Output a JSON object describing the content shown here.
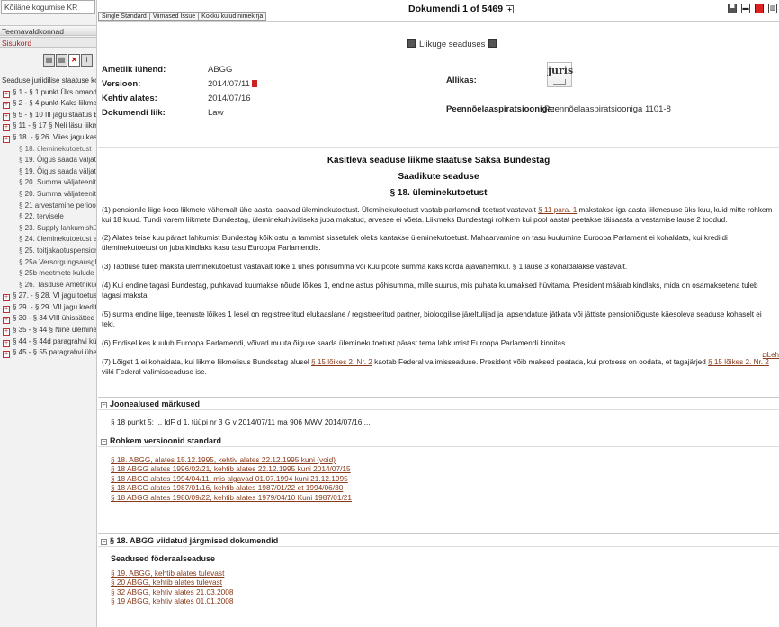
{
  "sidebar": {
    "title": "Kõiläne kogumise KR",
    "head1": "Teemavaldkonnad",
    "head2": "Sisukord",
    "icons": [
      "doc-icon",
      "doc-icon",
      "close-doc-icon",
      "info-icon"
    ],
    "tree": [
      {
        "text": "Seaduse juriidilise staatuse kohal Saks",
        "lvl": 0
      },
      {
        "text": "§ 1 - § 1 punkt Üks omandamist",
        "lvl": 1
      },
      {
        "text": "§ 2 - § 4 punkt Kaks liikmete Bur",
        "lvl": 1
      },
      {
        "text": "§ 5 - § 10 III jagu staatus Bunde",
        "lvl": 1
      },
      {
        "text": "§ 11 - § 17 § Neli läsu liikmed ...",
        "lvl": 1
      },
      {
        "text": "§ 18. - § 26. Viies jagu kasu end",
        "lvl": 1
      },
      {
        "text": "§ 18. üleminekutoetust",
        "lvl": 2,
        "selected": true
      },
      {
        "text": "§ 19. Õigus saada väljateenitud",
        "lvl": 2
      },
      {
        "text": "§ 19. Õigus saada väljateenitud",
        "lvl": 2
      },
      {
        "text": "§ 20. Summa väljateenitud aast",
        "lvl": 2
      },
      {
        "text": "§ 20. Summa väljateenitud aast",
        "lvl": 2
      },
      {
        "text": "§ 21 arvestamine perioodid teiste",
        "lvl": 2
      },
      {
        "text": "§ 22. tervisele",
        "lvl": 2
      },
      {
        "text": "§ 23. Supply lahkumishüvitist",
        "lvl": 2
      },
      {
        "text": "§ 24. üleminekutoetust ellujäänu",
        "lvl": 2
      },
      {
        "text": "§ 25. toitjakaotuspensionid",
        "lvl": 2
      },
      {
        "text": "§ 25a Versorgungsausgleich",
        "lvl": 2
      },
      {
        "text": "§ 25b meetmete kulude hoidmin",
        "lvl": 2
      },
      {
        "text": "§ 26. Tasduse Ametnikud õiguse",
        "lvl": 2
      },
      {
        "text": "§ 27. - § 28. VI jagu toetust kulu",
        "lvl": 1
      },
      {
        "text": "§ 29. - § 29. VII jagu krediteerim",
        "lvl": 1
      },
      {
        "text": "§ 30 - § 34 VIII ühissätted",
        "lvl": 1
      },
      {
        "text": "§ 35 - § 44 § Nine üleminekukor",
        "lvl": 1
      },
      {
        "text": "§ 44 - § 44d paragrahvi kümnes l",
        "lvl": 1
      },
      {
        "text": "§ 45 - § 55 paragrahvi üheteistku",
        "lvl": 1
      }
    ]
  },
  "topbar": {
    "tabs": [
      "Single Standard",
      "Viimased Issue",
      "Kokku kulud nimekirja"
    ],
    "doc_count": "Dokumendi 1 of 5469",
    "icons": [
      "save-icon",
      "print-icon",
      "pdf-icon",
      "layout-icon"
    ]
  },
  "main": {
    "link_law": "Liikuge seaduses",
    "meta": [
      {
        "label": "Ametlik lühend:",
        "value": "ABGG"
      },
      {
        "label": "Versioon:",
        "value": "2014/07/11"
      },
      {
        "label": "Kehtiv alates:",
        "value": "2014/07/16"
      },
      {
        "label": "Dokumendi liik:",
        "value": "Law"
      }
    ],
    "source_label": "Allikas:",
    "logo_text": "juris",
    "applicant_label": "Peennõelaaspiratsiooniga:",
    "applicant_value": "Peennõelaaspiratsiooniga 1101-8",
    "heading": [
      "Käsitleva seaduse liikme staatuse Saksa Bundestag",
      "Saadikute seaduse",
      "§ 18. üleminekutoetust"
    ],
    "p1_pre": "(1) pensionile liige koos liikmete vähemalt ühe aasta, saavad üleminekutoetust. Üleminekutoetust vastab parlamendi toetust vastavalt ",
    "p1_link": "§ 11 para. 1",
    "p1_post": " makstakse iga aasta liikmesuse üks kuu, kuid mitte rohkem kui 18 kuud. Tundi varem liikmete Bundestag, üleminekuhüvitiseks juba makstud, arvesse ei võeta. Liikmeks Bundestagi rohkem kui pool aastat peetakse täisaasta arvestamise lause 2 toodud.",
    "p2": "(2) Alates teise kuu pärast lahkumist Bundestag kõik ostu ja tammist sissetulek oleks kantakse üleminekutoetust. Mahaarvamine on tasu kuulumine Euroopa Parlament ei kohaldata, kui krediidi üleminekutoetust on juba kindlaks kasu tasu Euroopa Parlamendis.",
    "p3": "(3) Taotluse tuleb maksta üleminekutoetust vastavalt lõike 1 ühes põhisumma või kuu poole summa kaks korda ajavahemikul. § 1 lause 3 kohaldatakse vastavalt.",
    "p4": "(4) Kui endine tagasi Bundestag, puhkavad kuumakse nõude lõikes 1, endine astus põhisumma, mille suurus, mis puhata kuumaksed hüvitama. President määrab kindlaks, mida on osamaksetena tuleb tagasi maksta.",
    "p5": "(5) surma endine liige, teenuste lõikes 1 lesel on registreeritud elukaaslane / registreeritud partner, bioloogilise järeltulijad ja lapsendatute jätkata või jättiste pensioniõiguste käesoleva seaduse kohaselt ei teki.",
    "p6": "(6) Endisel kes kuulub Euroopa Parlamendi, võivad muuta õiguse saada üleminekutoetust pärast tema lahkumist Euroopa Parlamendi kinnitas.",
    "p7_a": "(7) Lõiget 1 ei kohaldata, kui liikme liikmelisus Bundestag alusel ",
    "p7_link1": "§ 15 lõikes 2. Nr. 2",
    "p7_b": " kaotab Federal valimisseaduse. President võib maksed peatada, kui protsess on oodata, et tagajärjed ",
    "p7_link2": "§ 15 lõikes 2. Nr. 2",
    "p7_c": " viiki Federal valimisseaduse ise.",
    "lehe": "Leh"
  },
  "footnotes": {
    "title": "Joonealused märkused",
    "text": "§ 18 punkt 5: ... IdF d 1. tüüpi nr 3 G v 2014/07/11 ma 906 MWV 2014/07/16 ..."
  },
  "versions": {
    "title": "Rohkem versioonid standard",
    "links": [
      "§ 18. ABGG, alates 15.12.1995, kehtiv alates 22.12.1995 kuni (void)",
      "§ 18 ABGG alates 1996/02/21, kehtib alates 22.12.1995 kuni 2014/07/15",
      "§ 18 ABGG alates 1994/04/11, mis algavad 01.07.1994 kuni 21.12.1995",
      "§ 18 ABGG alates 1987/01/16, kehtib alates 1987/01/22 et 1994/06/30",
      "§ 18 ABGG alates 1980/09/22, kehtib alates 1979/04/10 Kuni 1987/01/21"
    ]
  },
  "related": {
    "title": "§ 18. ABGG viidatud järgmised dokumendid",
    "subtitle": "Seadused föderaalseaduse",
    "links": [
      "§ 19. ABGG, kehtib alates tulevast",
      "§ 20 ABGG, kehtib alates tulevast",
      "§ 32 ABGG, kehtiv alates 21.03.2008",
      "§ 19 ABGG, kehtiv alates 01.01.2008"
    ]
  },
  "colors": {
    "link": "#8a3a1a",
    "accent_red": "#b12020"
  }
}
